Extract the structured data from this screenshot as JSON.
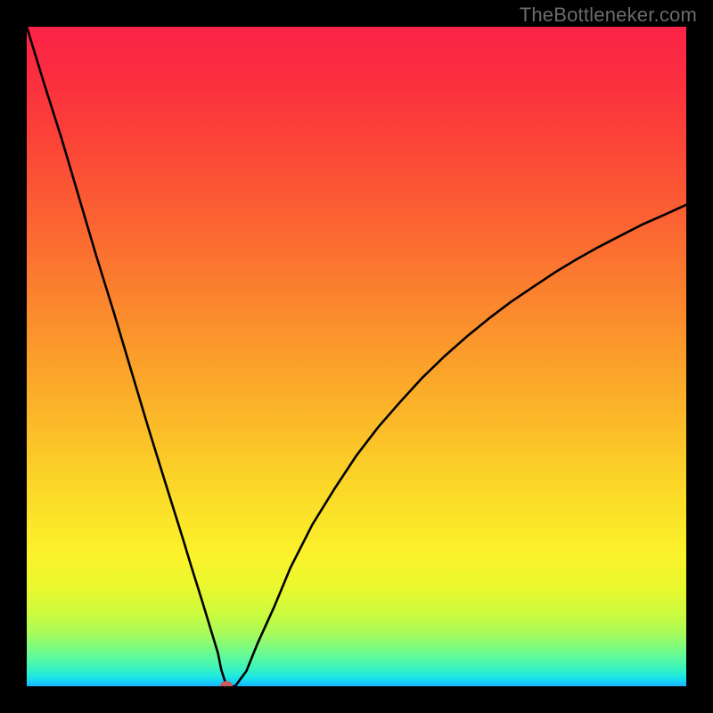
{
  "watermark": "TheBottleneker.com",
  "chart_data": {
    "type": "line",
    "title": "",
    "xlabel": "",
    "ylabel": "",
    "xlim": [
      0,
      100
    ],
    "ylim": [
      0,
      100
    ],
    "x": [
      0.0,
      2.6,
      5.3,
      7.9,
      10.5,
      13.2,
      15.8,
      18.4,
      21.1,
      23.7,
      25.0,
      26.6,
      28.0,
      29.0,
      29.5,
      30.3,
      31.6,
      33.3,
      35.0,
      37.5,
      40.0,
      43.3,
      46.7,
      50.0,
      53.3,
      56.7,
      60.0,
      63.3,
      66.7,
      70.0,
      73.3,
      76.7,
      80.0,
      83.3,
      86.7,
      90.0,
      93.3,
      96.7,
      100.0
    ],
    "y": [
      100.0,
      91.5,
      83.0,
      74.2,
      65.4,
      56.7,
      48.0,
      39.3,
      30.6,
      22.3,
      18.0,
      12.9,
      8.3,
      5.0,
      2.5,
      0.0,
      0.0,
      2.3,
      6.5,
      12.0,
      18.0,
      24.5,
      30.0,
      35.0,
      39.3,
      43.2,
      46.8,
      50.0,
      53.0,
      55.7,
      58.2,
      60.5,
      62.7,
      64.7,
      66.6,
      68.3,
      70.0,
      71.5,
      73.0
    ],
    "data_point": {
      "x": 30.3,
      "y": 0.0
    },
    "gradient_colors": {
      "top": "#fb2347",
      "mid_upper": "#fb8f2c",
      "mid": "#fbf22b",
      "mid_lower": "#7ffb7e",
      "bottom": "#17b4ff"
    },
    "line_color": "#000000",
    "point_color": "#c95b5b",
    "grid": false,
    "legend": false
  }
}
